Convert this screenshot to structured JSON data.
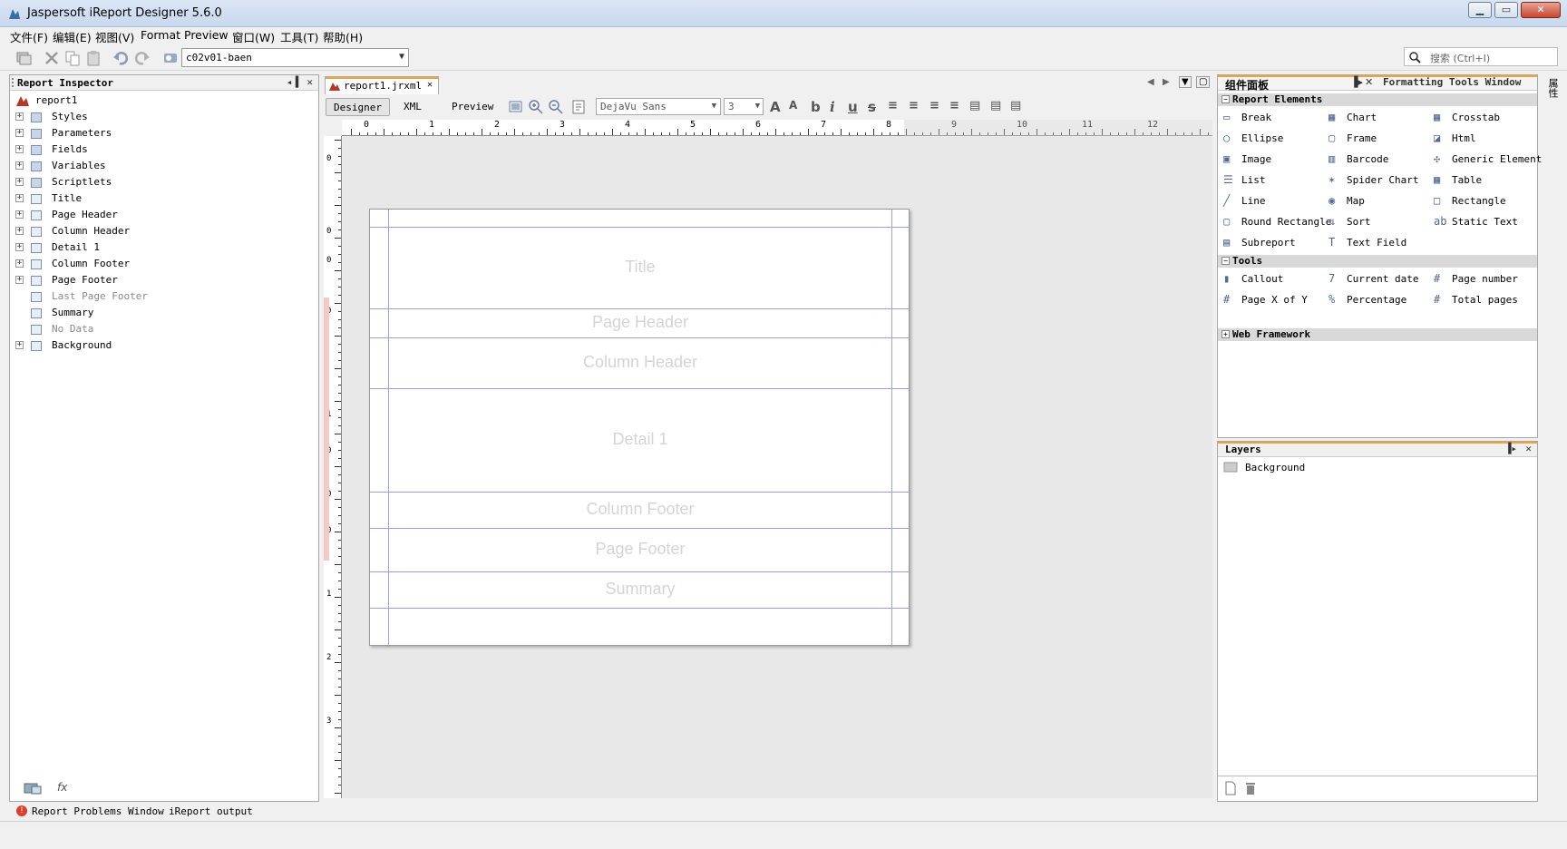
{
  "window": {
    "title": "Jaspersoft iReport Designer 5.6.0",
    "controls": {
      "minimize": "▁",
      "maximize": "▭",
      "close": "✕"
    }
  },
  "menu": [
    "文件(F)",
    "编辑(E)",
    "视图(V)",
    "Format",
    "Preview",
    "窗口(W)",
    "工具(T)",
    "帮助(H)"
  ],
  "toolbar": {
    "datasource": "c02v01-baen",
    "search_placeholder": "搜索 (Ctrl+I)"
  },
  "inspector": {
    "title": "Report Inspector",
    "root": "report1",
    "items": [
      {
        "label": "Styles",
        "icon": "styles-icon",
        "expandable": true,
        "enabled": true
      },
      {
        "label": "Parameters",
        "icon": "parameters-icon",
        "expandable": true,
        "enabled": true
      },
      {
        "label": "Fields",
        "icon": "fields-icon",
        "expandable": true,
        "enabled": true
      },
      {
        "label": "Variables",
        "icon": "variables-icon",
        "expandable": true,
        "enabled": true
      },
      {
        "label": "Scriptlets",
        "icon": "scriptlets-icon",
        "expandable": true,
        "enabled": true
      },
      {
        "label": "Title",
        "icon": "band-icon",
        "expandable": true,
        "enabled": true
      },
      {
        "label": "Page Header",
        "icon": "band-icon",
        "expandable": true,
        "enabled": true
      },
      {
        "label": "Column Header",
        "icon": "band-icon",
        "expandable": true,
        "enabled": true
      },
      {
        "label": "Detail 1",
        "icon": "band-icon",
        "expandable": true,
        "enabled": true
      },
      {
        "label": "Column Footer",
        "icon": "band-icon",
        "expandable": true,
        "enabled": true
      },
      {
        "label": "Page Footer",
        "icon": "band-icon",
        "expandable": true,
        "enabled": true
      },
      {
        "label": "Last Page Footer",
        "icon": "band-icon",
        "expandable": false,
        "enabled": false
      },
      {
        "label": "Summary",
        "icon": "band-icon",
        "expandable": false,
        "enabled": true
      },
      {
        "label": "No Data",
        "icon": "band-icon",
        "expandable": false,
        "enabled": false
      },
      {
        "label": "Background",
        "icon": "band-icon",
        "expandable": true,
        "enabled": true
      }
    ]
  },
  "editor": {
    "tab": "report1.jrxml",
    "views": [
      "Designer",
      "XML",
      "Preview"
    ],
    "font": "DejaVu Sans",
    "font_size": "3",
    "ruler_h": [
      "0",
      "1",
      "2",
      "3",
      "4",
      "5",
      "6",
      "7",
      "8",
      "9",
      "10",
      "11",
      "12"
    ],
    "ruler_v": [
      "0",
      "0",
      "0",
      "0",
      "1",
      "0",
      "0",
      "0",
      "1",
      "2",
      "3"
    ],
    "bands": [
      "Title",
      "Page Header",
      "Column Header",
      "Detail 1",
      "Column Footer",
      "Page Footer",
      "Summary"
    ]
  },
  "palette": {
    "title": "组件面板",
    "formatting_tab": "Formatting Tools Window",
    "sections": {
      "report_elements": "Report Elements",
      "tools": "Tools",
      "web_framework": "Web Framework"
    },
    "report_elements": [
      "Break",
      "Chart",
      "Crosstab",
      "Ellipse",
      "Frame",
      "Html",
      "Image",
      "Barcode",
      "Generic Element",
      "List",
      "Spider Chart",
      "Table",
      "Line",
      "Map",
      "Rectangle",
      "Round Rectangle",
      "Sort",
      "Static Text",
      "Subreport",
      "Text Field"
    ],
    "tools": [
      "Callout",
      "Current date",
      "Page number",
      "Page X of Y",
      "Percentage",
      "Total pages"
    ]
  },
  "layers": {
    "title": "Layers",
    "items": [
      "Background"
    ]
  },
  "side_tab": "属性",
  "bottom_tabs": [
    "Report Problems Window",
    "iReport output"
  ]
}
